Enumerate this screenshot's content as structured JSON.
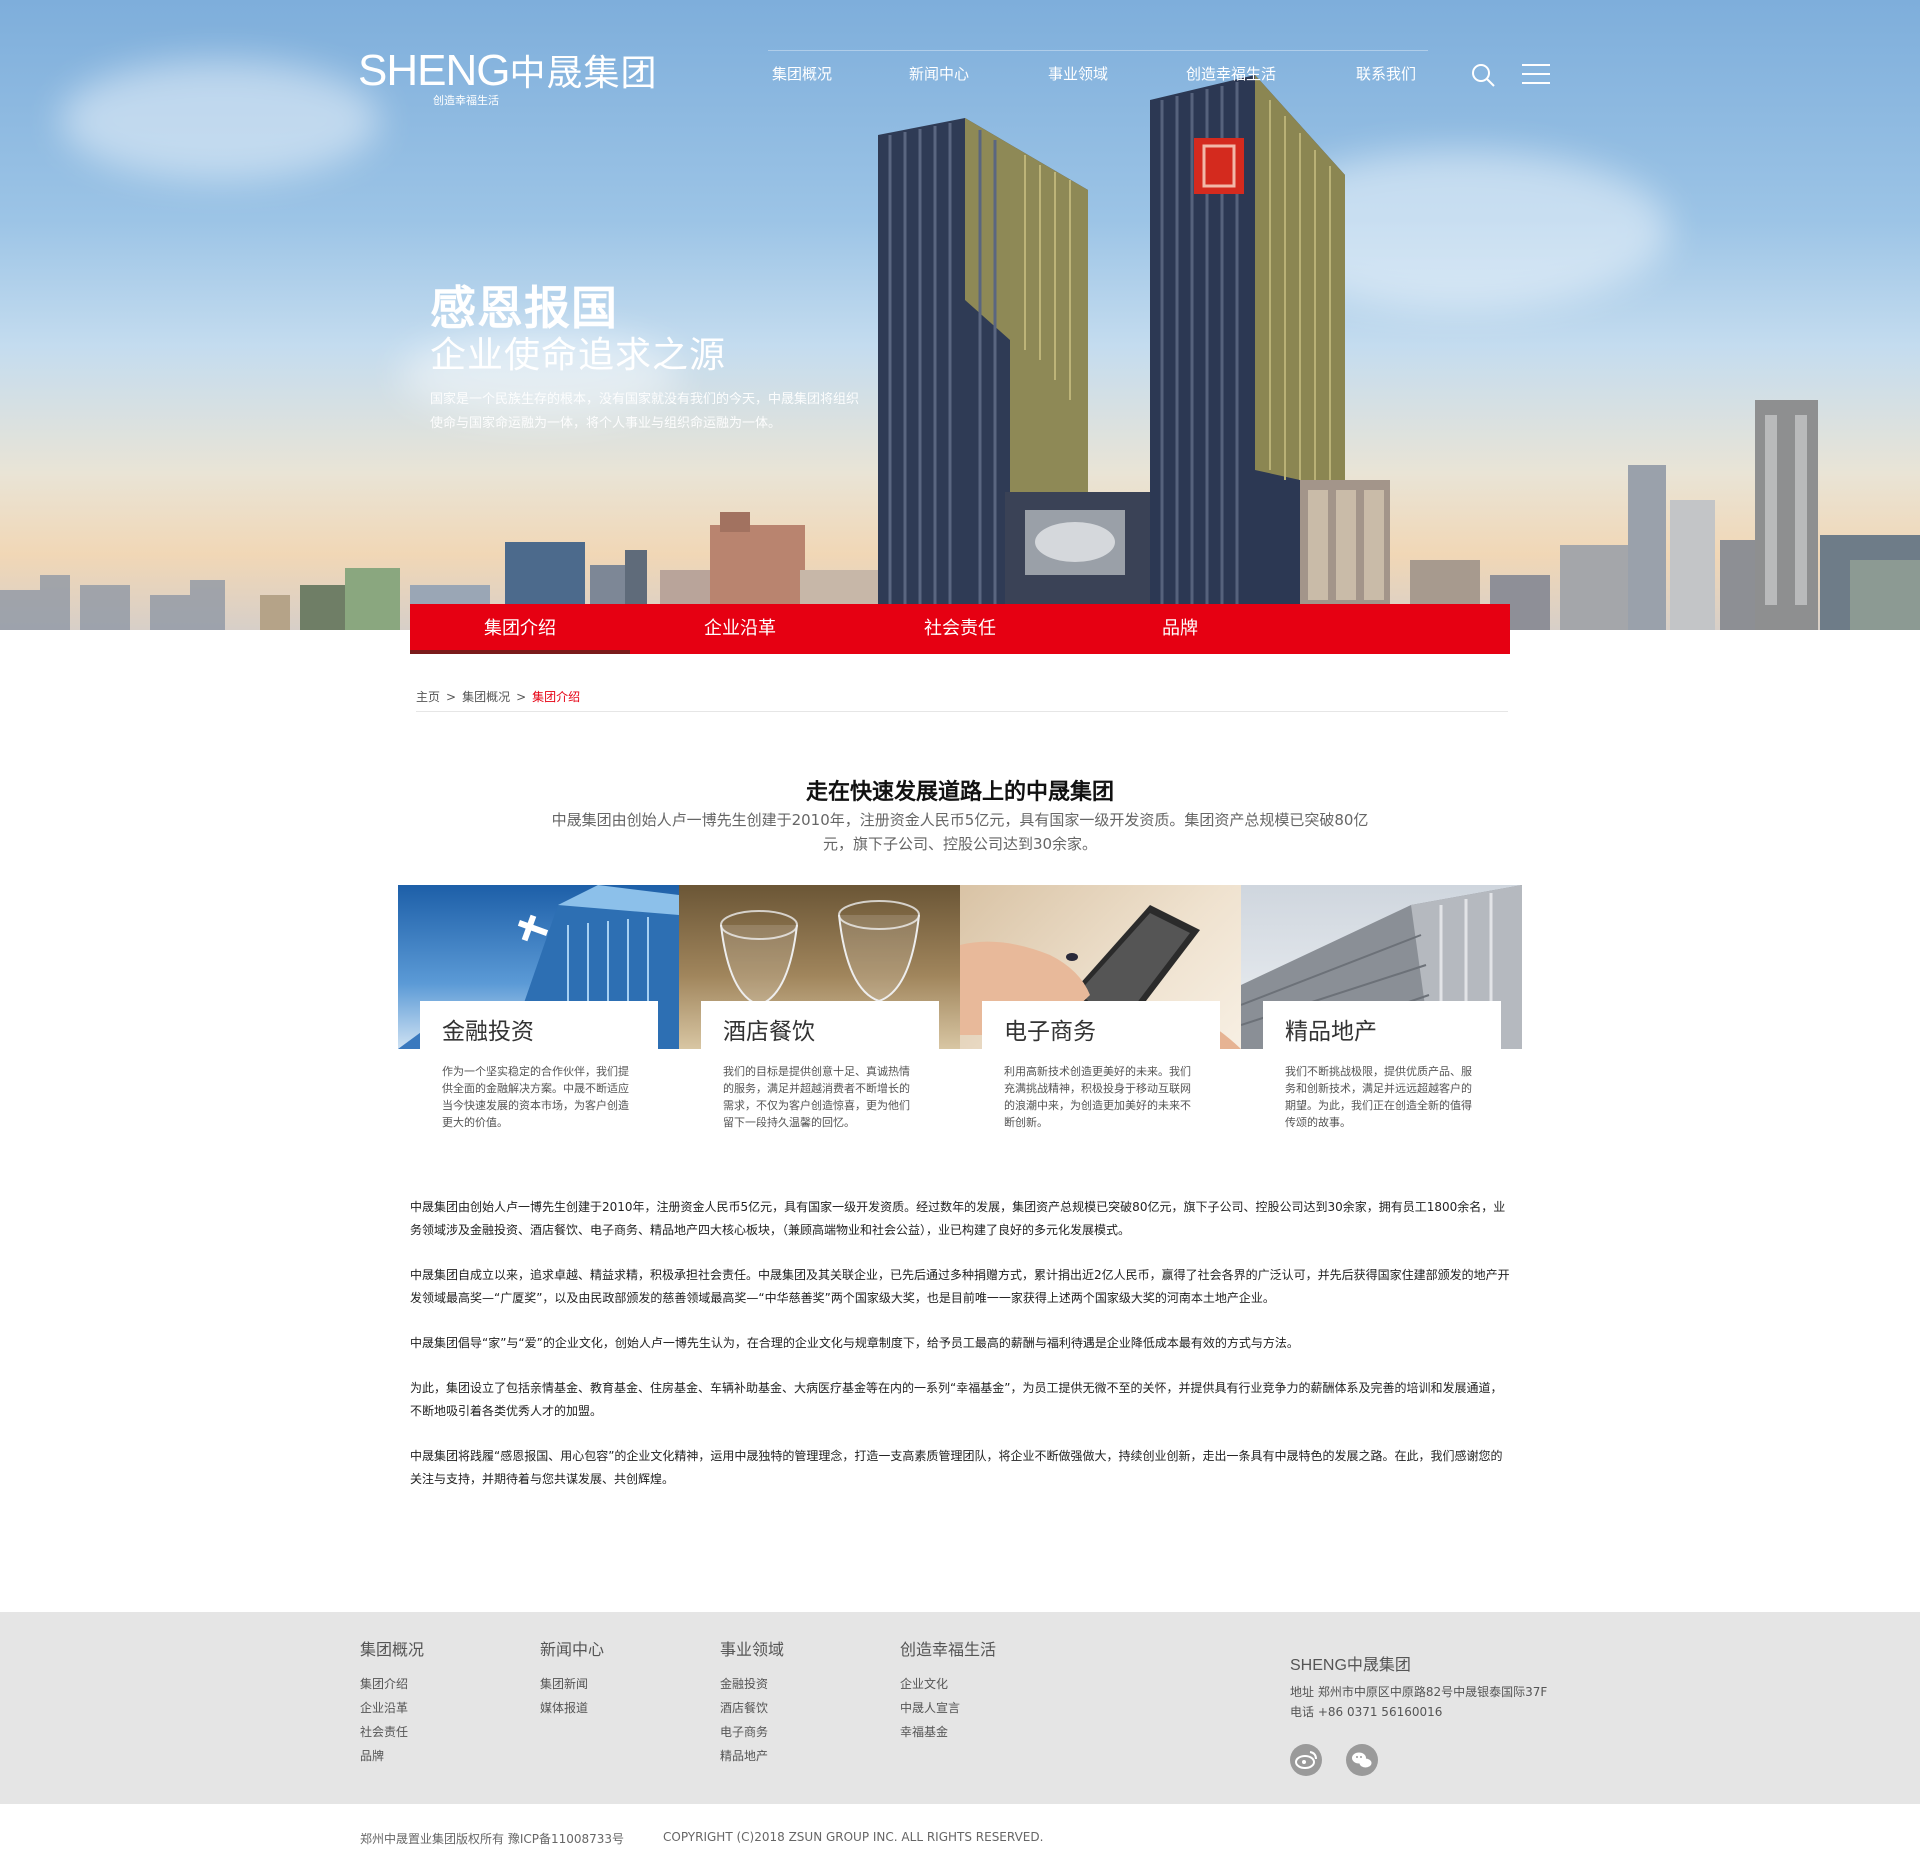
{
  "header": {
    "logo_text": "SHENG",
    "logo_cn": "中晟集团",
    "logo_slogan": "创造幸福生活",
    "nav": [
      "集团概况",
      "新闻中心",
      "事业领域",
      "创造幸福生活",
      "联系我们"
    ],
    "icons": [
      "search-icon",
      "menu-icon"
    ]
  },
  "hero": {
    "title": "感恩报国",
    "subtitle": "企业使命追求之源",
    "text": "国家是一个民族生存的根本，没有国家就没有我们的今天，中晟集团将组织使命与国家命运融为一体，将个人事业与组织命运融为一体。"
  },
  "subnav": {
    "items": [
      "集团介绍",
      "企业沿革",
      "社会责任",
      "品牌"
    ],
    "active": "集团介绍"
  },
  "breadcrumb": [
    "主页",
    ">",
    "集团概况",
    ">",
    "集团介绍"
  ],
  "intro": {
    "title": "走在快速发展道路上的中晟集团",
    "text": "中晟集团由创始人卢一博先生创建于2010年，注册资金人民币5亿元，具有国家一级开发资质。集团资产总规模已突破80亿元，旗下子公司、控股公司达到30余家。"
  },
  "cards": [
    {
      "title": "金融投资",
      "desc": "作为一个坚实稳定的合作伙伴，我们提供全面的金融解决方案。中晟不断适应当今快速发展的资本市场，为客户创造更大的价值。"
    },
    {
      "title": "酒店餐饮",
      "desc": "我们的目标是提供创意十足、真诚热情的服务，满足并超越消费者不断增长的需求，不仅为客户创造惊喜，更为他们留下一段持久温馨的回忆。"
    },
    {
      "title": "电子商务",
      "desc": "利用高新技术创造更美好的未来。我们充满挑战精神，积极投身于移动互联网的浪潮中来，为创造更加美好的未来不断创新。"
    },
    {
      "title": "精品地产",
      "desc": "我们不断挑战极限，提供优质产品、服务和创新技术，满足并远远超越客户的期望。为此，我们正在创造全新的值得传颂的故事。"
    }
  ],
  "body": [
    "中晟集团由创始人卢一博先生创建于2010年，注册资金人民币5亿元，具有国家一级开发资质。经过数年的发展，集团资产总规模已突破80亿元，旗下子公司、控股公司达到30余家，拥有员工1800余名，业务领域涉及金融投资、酒店餐饮、电子商务、精品地产四大核心板块，（兼顾高端物业和社会公益），业已构建了良好的多元化发展模式。",
    "中晟集团自成立以来，追求卓越、精益求精，积极承担社会责任。中晟集团及其关联企业，已先后通过多种捐赠方式，累计捐出近2亿人民币，赢得了社会各界的广泛认可，并先后获得国家住建部颁发的地产开发领域最高奖—“广厦奖”，以及由民政部颁发的慈善领域最高奖—“中华慈善奖”两个国家级大奖，也是目前唯一一家获得上述两个国家级大奖的河南本土地产企业。",
    "中晟集团倡导“家”与“爱”的企业文化，创始人卢一博先生认为，在合理的企业文化与规章制度下，给予员工最高的薪酬与福利待遇是企业降低成本最有效的方式与方法。",
    "为此，集团设立了包括亲情基金、教育基金、住房基金、车辆补助基金、大病医疗基金等在内的一系列“幸福基金”，为员工提供无微不至的关怀，并提供具有行业竞争力的薪酬体系及完善的培训和发展通道，不断地吸引着各类优秀人才的加盟。",
    "中晟集团将践履“感恩报国、用心包容”的企业文化精神，运用中晟独特的管理理念，打造一支高素质管理团队，将企业不断做强做大，持续创业创新，走出一条具有中晟特色的发展之路。在此，我们感谢您的关注与支持，并期待着与您共谋发展、共创辉煌。"
  ],
  "footer": {
    "columns": [
      {
        "title": "集团概况",
        "links": [
          "集团介绍",
          "企业沿革",
          "社会责任",
          "品牌"
        ]
      },
      {
        "title": "新闻中心",
        "links": [
          "集团新闻",
          "媒体报道"
        ]
      },
      {
        "title": "事业领域",
        "links": [
          "金融投资",
          "酒店餐饮",
          "电子商务",
          "精品地产"
        ]
      },
      {
        "title": "创造幸福生活",
        "links": [
          "企业文化",
          "中晟人宣言",
          "幸福基金"
        ]
      }
    ],
    "logo_text": "SHENG中晟集团",
    "address": "地址  郑州市中原区中原路82号中晟银泰国际37F",
    "phone": "电话  +86 0371 56160016",
    "social_icons": [
      "weibo-icon",
      "wechat-icon"
    ]
  },
  "copyright": {
    "left": "郑州中晟置业集团版权所有 豫ICP备11008733号",
    "right": "COPYRIGHT (C)2018 ZSUN GROUP INC. ALL RIGHTS RESERVED."
  },
  "colors": {
    "brand_red": "#e60012",
    "footer_bg": "#e5e5e5"
  }
}
